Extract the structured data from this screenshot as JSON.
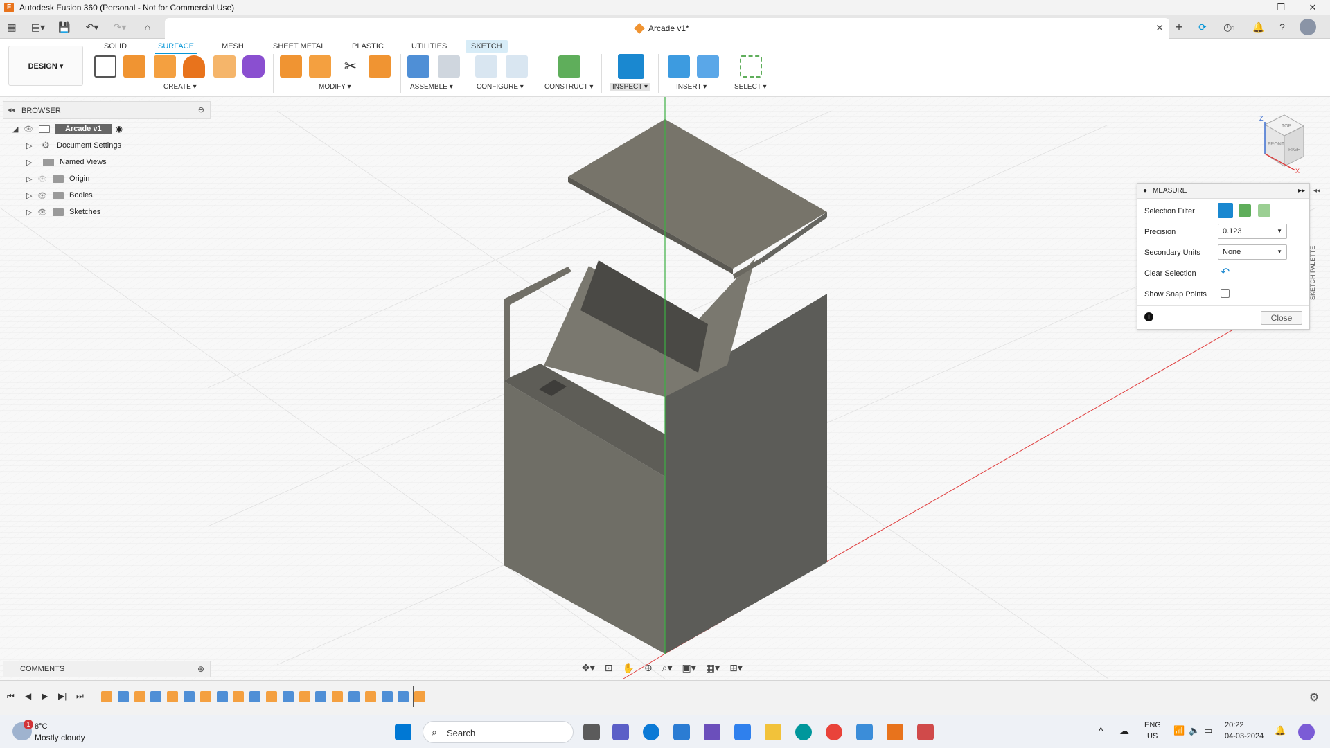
{
  "window": {
    "title": "Autodesk Fusion 360 (Personal - Not for Commercial Use)",
    "controls": [
      "minimize",
      "maximize",
      "close"
    ]
  },
  "document": {
    "tab_name": "Arcade v1*",
    "badge_count": "1"
  },
  "workspace": {
    "design_label": "DESIGN ▾"
  },
  "menu_tabs": [
    {
      "label": "SOLID"
    },
    {
      "label": "SURFACE"
    },
    {
      "label": "MESH"
    },
    {
      "label": "SHEET METAL"
    },
    {
      "label": "PLASTIC"
    },
    {
      "label": "UTILITIES"
    },
    {
      "label": "SKETCH"
    }
  ],
  "tool_groups": [
    {
      "label": "CREATE ▾"
    },
    {
      "label": "MODIFY ▾"
    },
    {
      "label": "ASSEMBLE ▾"
    },
    {
      "label": "CONFIGURE ▾"
    },
    {
      "label": "CONSTRUCT ▾"
    },
    {
      "label": "INSPECT ▾"
    },
    {
      "label": "INSERT ▾"
    },
    {
      "label": "SELECT ▾"
    }
  ],
  "browser": {
    "title": "BROWSER",
    "root": "Arcade v1",
    "items": [
      {
        "label": "Document Settings",
        "icon": "gear-icon"
      },
      {
        "label": "Named Views",
        "icon": "folder-icon"
      },
      {
        "label": "Origin",
        "icon": "folder-icon"
      },
      {
        "label": "Bodies",
        "icon": "folder-icon"
      },
      {
        "label": "Sketches",
        "icon": "folder-icon"
      }
    ]
  },
  "comments": {
    "title": "COMMENTS"
  },
  "measure": {
    "title": "MEASURE",
    "selection_filter_label": "Selection Filter",
    "precision_label": "Precision",
    "precision_value": "0.123",
    "secondary_units_label": "Secondary Units",
    "secondary_units_value": "None",
    "clear_selection_label": "Clear Selection",
    "show_snap_points_label": "Show Snap Points",
    "close_label": "Close"
  },
  "viewcube": {
    "top": "TOP",
    "front": "FRONT",
    "right": "RIGHT",
    "axis_z": "Z",
    "axis_x": "X"
  },
  "sketch_palette": {
    "label": "SKETCH PALETTE"
  },
  "taskbar": {
    "weather_temp": "8°C",
    "weather_desc": "Mostly cloudy",
    "weather_badge": "1",
    "search_placeholder": "Search",
    "language": "ENG",
    "region": "US",
    "time": "20:22",
    "date": "04-03-2024"
  },
  "colors": {
    "accent": "#0696d7",
    "model_face_front": "#6f6e66",
    "model_face_side": "#5c5c58",
    "model_face_top": "#77746a",
    "axis_green": "#3cb043",
    "axis_red": "#e03c3c"
  }
}
